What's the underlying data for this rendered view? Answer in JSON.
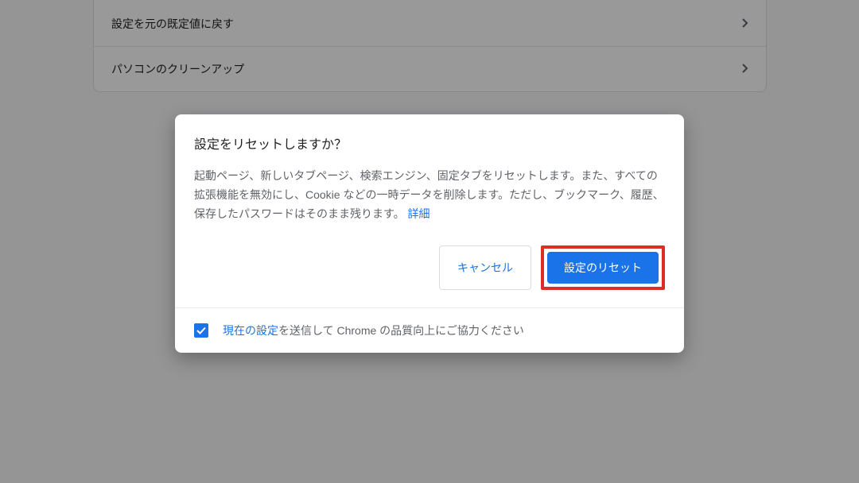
{
  "background": {
    "items": [
      {
        "label": "設定を元の既定値に戻す"
      },
      {
        "label": "パソコンのクリーンアップ"
      }
    ]
  },
  "dialog": {
    "title": "設定をリセットしますか？",
    "description": "起動ページ、新しいタブページ、検索エンジン、固定タブをリセットします。また、すべての拡張機能を無効にし、Cookie などの一時データを削除します。ただし、ブックマーク、履歴、保存したパスワードはそのまま残ります。 ",
    "detailsLink": "詳細",
    "cancel": "キャンセル",
    "confirm": "設定のリセット",
    "footer": {
      "linkText": "現在の設定",
      "restText": "を送信して Chrome の品質向上にご協力ください"
    }
  }
}
